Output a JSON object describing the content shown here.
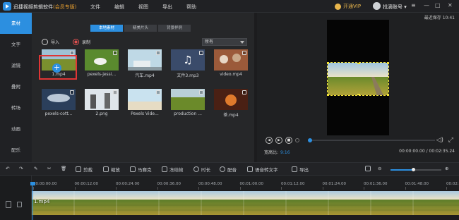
{
  "titlebar": {
    "app_name": "迅捷视频剪辑软件",
    "edition": "(会员专版)",
    "menu": [
      "文件",
      "编辑",
      "视图",
      "导出",
      "帮助"
    ],
    "vip_label": "开通VIP",
    "account_label": "找滴账号"
  },
  "sidebar": {
    "items": [
      "素材",
      "文字",
      "滤镜",
      "叠附",
      "转场",
      "动画",
      "配乐"
    ],
    "active_index": 0
  },
  "media": {
    "tabs": [
      "本地素材",
      "精美片头",
      "背景样例"
    ],
    "active_tab": 0,
    "import_label": "导入",
    "record_label": "录制",
    "filter_value": "所有",
    "items": [
      {
        "name": "1.mp4",
        "kind": "field"
      },
      {
        "name": "pexels-jessi...",
        "kind": "dog"
      },
      {
        "name": "汽车.mp4",
        "kind": "car"
      },
      {
        "name": "文件3.mp3",
        "kind": "music"
      },
      {
        "name": "video.mp4",
        "kind": "people"
      },
      {
        "name": "pexels-cott...",
        "kind": "sky"
      },
      {
        "name": "2.png",
        "kind": "snow"
      },
      {
        "name": "Pexels Vide...",
        "kind": "beach"
      },
      {
        "name": "production ...",
        "kind": "field2"
      },
      {
        "name": "茶.mp4",
        "kind": "tea"
      }
    ]
  },
  "preview": {
    "last_saved": "最近保存 10:41",
    "aspect_label": "宽高比:",
    "aspect_value": "9:16",
    "time_display": "00:00:00.00 / 00:02:35.24",
    "progress": 0
  },
  "toolbar": {
    "tools": [
      "剪裁",
      "缩放",
      "马赛克",
      "冻结帧",
      "时长",
      "配音",
      "语音转文字",
      "导出"
    ],
    "zoom_level": 0.45
  },
  "timeline": {
    "ticks": [
      "00:00:00.00",
      "00:00:12.00",
      "00:00:24.00",
      "00:00:36.00",
      "00:00:48.00",
      "00:01:00.00",
      "00:01:12.00",
      "00:01:24.00",
      "00:01:36.00",
      "00:01:48.00",
      "00:02:00.00"
    ],
    "clip_label": "1.mp4"
  },
  "colors": {
    "accent": "#2c8fe0",
    "vip": "#e8b64c",
    "selection": "#e03535",
    "crop_frame": "#f2e236"
  }
}
